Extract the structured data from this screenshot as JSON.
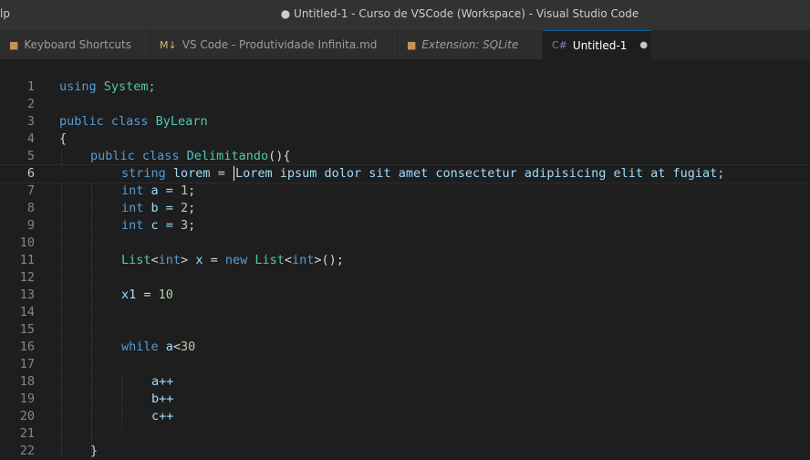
{
  "window": {
    "menu_stub": "lp",
    "title": "● Untitled-1 - Curso de VSCode (Workspace) - Visual Studio Code"
  },
  "tabs": [
    {
      "icon": "■",
      "label": "Keyboard Shortcuts",
      "color": "#c09553"
    },
    {
      "icon": "M↓",
      "label": "VS Code - Produtividade Infinita.md",
      "color": "#dcb66e"
    },
    {
      "icon": "■",
      "label": "Extension: SQLite",
      "color": "#c09553"
    },
    {
      "icon": "C#",
      "label": "Untitled-1",
      "dirty_marker": "●",
      "color": "#a074c4"
    }
  ],
  "editor": {
    "active_line": 6,
    "lines": [
      {
        "n": "1"
      },
      {
        "n": "2"
      },
      {
        "n": "3"
      },
      {
        "n": "4"
      },
      {
        "n": "5"
      },
      {
        "n": "6"
      },
      {
        "n": "7"
      },
      {
        "n": "8"
      },
      {
        "n": "9"
      },
      {
        "n": "10"
      },
      {
        "n": "11"
      },
      {
        "n": "12"
      },
      {
        "n": "13"
      },
      {
        "n": "14"
      },
      {
        "n": "15"
      },
      {
        "n": "16"
      },
      {
        "n": "17"
      },
      {
        "n": "18"
      },
      {
        "n": "19"
      },
      {
        "n": "20"
      },
      {
        "n": "21"
      },
      {
        "n": "22"
      }
    ],
    "code": {
      "l1_kw": "using",
      "l1_rest": " System;",
      "l3_kw": "public class",
      "l3_name": " ByLearn",
      "l4": "{",
      "l5_kw": "public class",
      "l5_name": " Delimitando",
      "l5_rest": "(){",
      "l6_kw": "string",
      "l6_var": " lorem",
      "l6_eq": " = ",
      "l6_text": "Lorem ipsum dolor sit amet consectetur adipisicing elit at fugiat;",
      "l7_kw": "int",
      "l7_rest": " a = ",
      "l7_num": "1",
      "l8_kw": "int",
      "l8_rest": " b = ",
      "l8_num": "2",
      "l9_kw": "int",
      "l9_rest": " c = ",
      "l9_num": "3",
      "l11_t1": "List",
      "l11_p1": "<",
      "l11_t2": "int",
      "l11_p2": ">",
      "l11_var": " x",
      "l11_eq": " = ",
      "l11_kw": "new",
      "l11_t3": " List",
      "l11_p3": "<",
      "l11_t4": "int",
      "l11_p4": ">();",
      "l13_var": "x1",
      "l13_eq": " = ",
      "l13_num": "10",
      "l16_kw": "while",
      "l16_var": " a",
      "l16_op": "<",
      "l16_num": "30",
      "l18": "a++",
      "l19": "b++",
      "l20": "c++",
      "l22": "}"
    }
  }
}
